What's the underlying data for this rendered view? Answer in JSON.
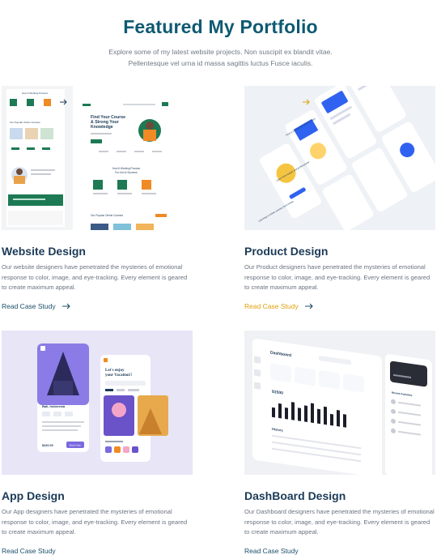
{
  "header": {
    "title": "Featured My Portfolio",
    "subtitle": "Explore some of my latest website projects. Non suscipit ex blandit vitae. Pellentesque vel urna id massa sagittis luctus Fusce iaculis."
  },
  "cards": [
    {
      "title": "Website Design",
      "description": "Our website designers have penetrated the mysteries of emotional response to color, image,  and eye-tracking. Every element is geared to create maximum appeal.",
      "link": "Read Case Study",
      "link_color": "#1b4e6b",
      "thumb": {
        "hero": "Find Your Course & Strong Your Knowledge",
        "process": "How It Working Process For Join & Success",
        "popular": "Our Popular Online Courses"
      }
    },
    {
      "title": "Product Design",
      "description": "Our Product designers have penetrated the mysteries of emotional response to color, image,  and eye-tracking. Every element is geared to create maximum appeal.",
      "link": "Read Case Study",
      "link_color": "#e0a20c",
      "thumb": {
        "screen1": "Find a course you want to learn",
        "screen2": "Learn from expert and professional",
        "screen3": "Learning is online classes from home"
      }
    },
    {
      "title": "App Design",
      "description": "Our App designers have penetrated the mysteries of emotional response to color, image,  and eye-tracking. Every element is geared to create maximum appeal.",
      "link": "Read Case Study",
      "link_color": "#1b4e6b",
      "thumb": {
        "place": "Bali, Indonesia",
        "question": "Let's enjoy your Vacation!!",
        "price": "$320.00",
        "button": "Book Now"
      }
    },
    {
      "title": "DashBoard Design",
      "description": "Our Dashboard designers have penetrated the mysteries of emotional response to color, image,  and eye-tracking. Every element is geared to create maximum appeal.",
      "link": "Read Case Study",
      "link_color": "#1b4e6b",
      "thumb": {
        "heading": "Dashboard",
        "amount": "$1500",
        "history": "History",
        "recent": "Recent Activities"
      }
    }
  ],
  "colors": {
    "title": "#0e5a73",
    "heading": "#1b3a57",
    "accent_green": "#1d7a54",
    "accent_blue": "#2f62f0",
    "accent_purple": "#7a6ae0",
    "accent_orange": "#f08a24"
  },
  "icons": [
    "arrow-right-icon"
  ]
}
